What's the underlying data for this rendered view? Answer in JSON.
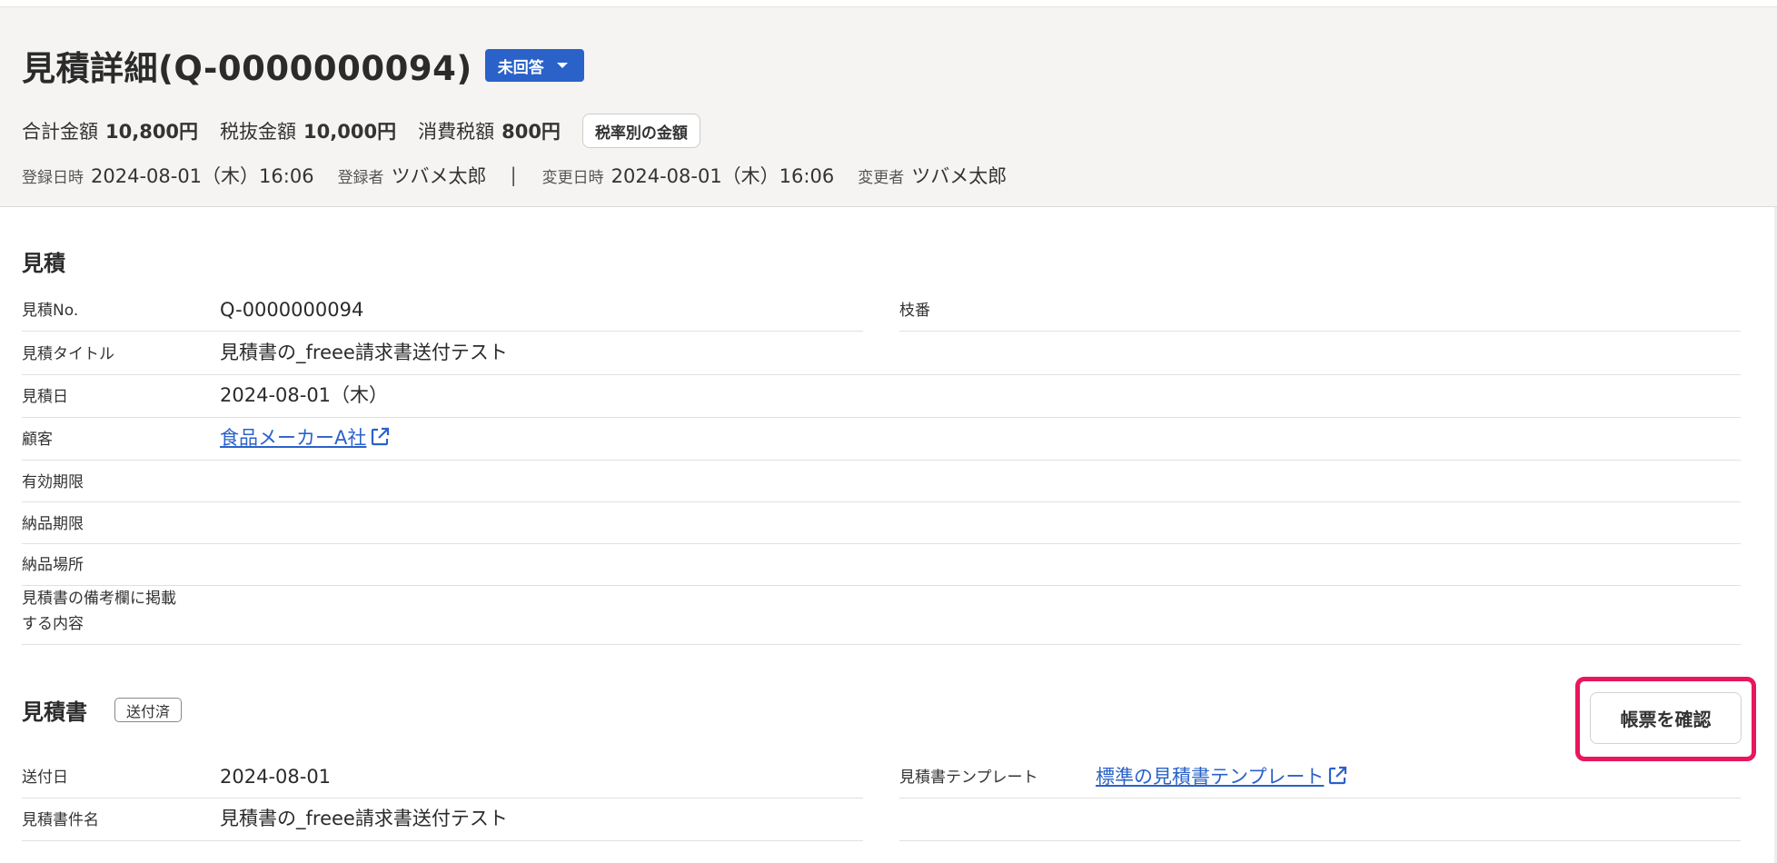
{
  "header": {
    "title": "見積詳細(Q-0000000094)",
    "status_label": "未回答",
    "amounts": {
      "total_label": "合計金額",
      "total_value": "10,800円",
      "pretax_label": "税抜金額",
      "pretax_value": "10,000円",
      "tax_label": "消費税額",
      "tax_value": "800円",
      "tax_breakdown_button": "税率別の金額"
    },
    "meta": {
      "created_at_label": "登録日時",
      "created_at_value": "2024-08-01（木）16:06",
      "created_by_label": "登録者",
      "created_by_value": "ツバメ太郎",
      "separator": "|",
      "updated_at_label": "変更日時",
      "updated_at_value": "2024-08-01（木）16:06",
      "updated_by_label": "変更者",
      "updated_by_value": "ツバメ太郎"
    }
  },
  "quote_section": {
    "title": "見積",
    "fields": {
      "number_label": "見積No.",
      "number_value": "Q-0000000094",
      "branch_label": "枝番",
      "title_label": "見積タイトル",
      "title_value": "見積書の_freee請求書送付テスト",
      "date_label": "見積日",
      "date_value": "2024-08-01（木）",
      "customer_label": "顧客",
      "customer_value": "食品メーカーA社",
      "expiry_label": "有効期限",
      "delivery_deadline_label": "納品期限",
      "delivery_place_label": "納品場所",
      "remarks_label_line1": "見積書の備考欄に掲載",
      "remarks_label_line2": "する内容"
    }
  },
  "document_section": {
    "title": "見積書",
    "status_badge": "送付済",
    "confirm_button": "帳票を確認",
    "fields": {
      "sent_date_label": "送付日",
      "sent_date_value": "2024-08-01",
      "template_label": "見積書テンプレート",
      "template_value": "標準の見積書テンプレート",
      "doc_name_label": "見積書件名",
      "doc_name_value": "見積書の_freee請求書送付テスト"
    }
  },
  "colors": {
    "accent": "#2a62c9",
    "highlight": "#e8175d",
    "header_bg": "#f5f4f2"
  },
  "icons": [
    "external-link-icon",
    "caret-down-icon"
  ]
}
